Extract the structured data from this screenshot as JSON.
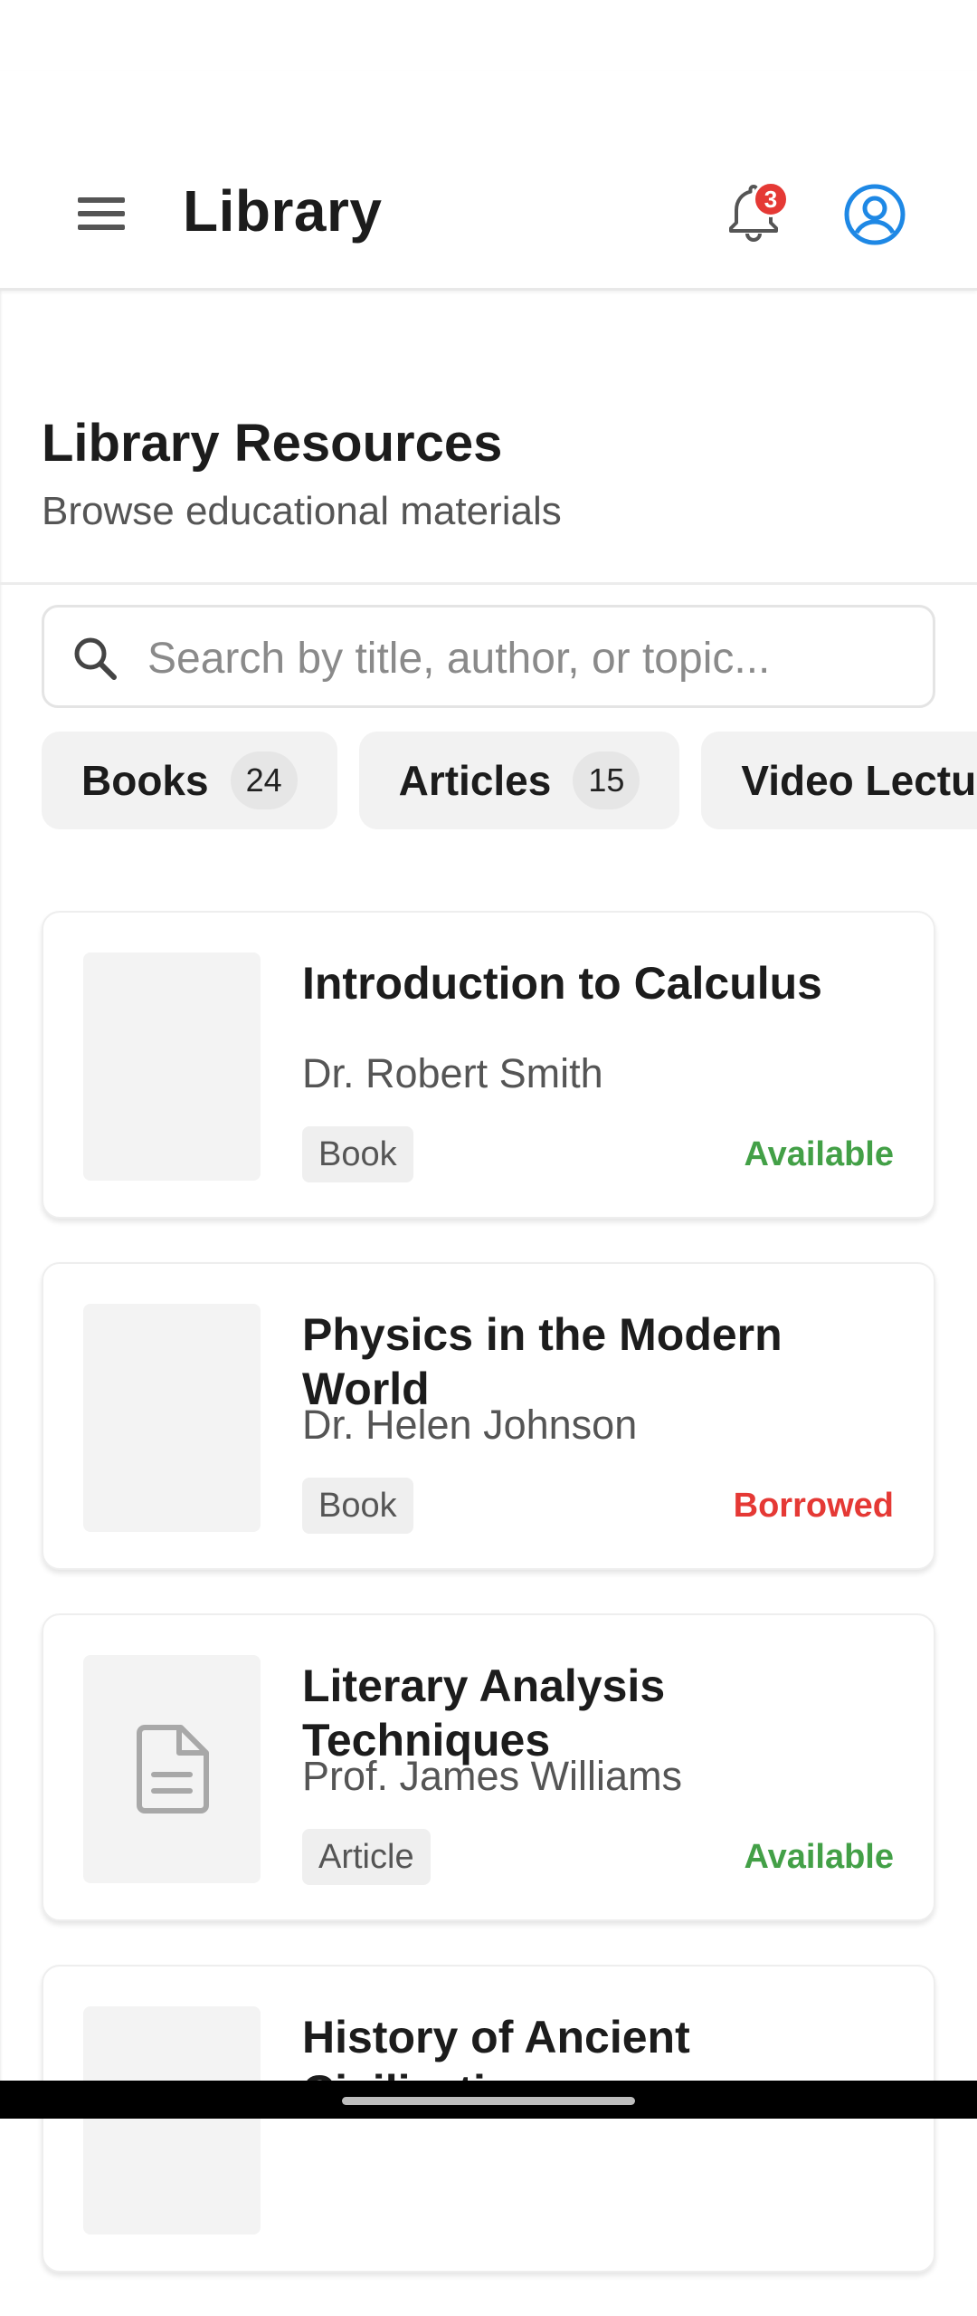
{
  "app_bar": {
    "title": "Library",
    "notification_count": "3"
  },
  "header": {
    "title": "Library Resources",
    "subtitle": "Browse educational materials"
  },
  "search": {
    "placeholder": "Search by title, author, or topic..."
  },
  "filters": [
    {
      "label": "Books",
      "count": "24"
    },
    {
      "label": "Articles",
      "count": "15"
    },
    {
      "label": "Video Lectures",
      "count": ""
    }
  ],
  "resources": [
    {
      "title": "Introduction to Calculus",
      "author": "Dr. Robert Smith",
      "type": "Book",
      "status": "Available",
      "status_color": "#43a047",
      "icon": ""
    },
    {
      "title": "Physics in the Modern World",
      "author": "Dr. Helen Johnson",
      "type": "Book",
      "status": "Borrowed",
      "status_color": "#e53935",
      "icon": ""
    },
    {
      "title": "Literary Analysis Techniques",
      "author": "Prof. James Williams",
      "type": "Article",
      "status": "Available",
      "status_color": "#43a047",
      "icon": "document-icon"
    },
    {
      "title": "History of Ancient Civilizations",
      "author": "",
      "type": "",
      "status": "",
      "status_color": "",
      "icon": ""
    }
  ],
  "colors": {
    "accent": "#1e88e5",
    "available": "#43a047",
    "borrowed": "#e53935",
    "badge": "#e53935"
  }
}
